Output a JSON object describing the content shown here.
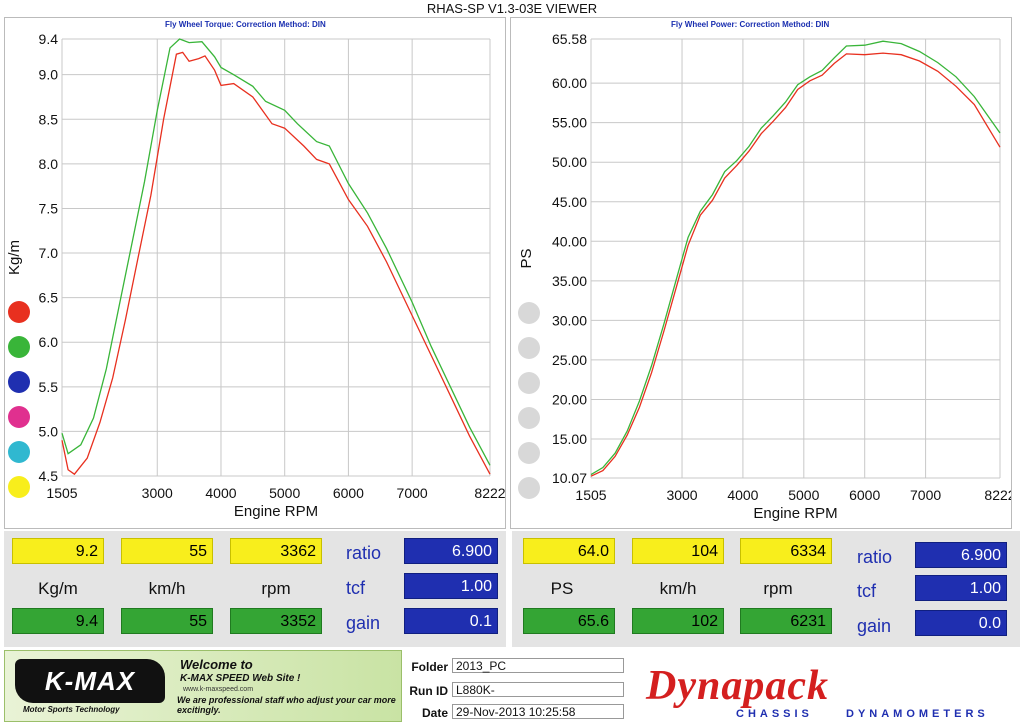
{
  "window_title": "RHAS-SP V1.3-03E VIEWER",
  "chart_data": [
    {
      "type": "line",
      "title": "Fly Wheel Torque:    Correction Method: DIN",
      "xlabel": "Engine RPM",
      "ylabel": "Kg/m",
      "xlim": [
        1505,
        8222
      ],
      "ylim": [
        4.5,
        9.4
      ],
      "x_ticks": [
        "1505",
        "3000",
        "4000",
        "5000",
        "6000",
        "7000",
        "8222"
      ],
      "y_ticks": [
        "4.5",
        "5.0",
        "5.5",
        "6.0",
        "6.5",
        "7.0",
        "7.5",
        "8.0",
        "8.5",
        "9.0",
        "9.4"
      ],
      "grid": true,
      "series": [
        {
          "color": "#39b539",
          "points": [
            [
              1505,
              4.98
            ],
            [
              1600,
              4.75
            ],
            [
              1800,
              4.85
            ],
            [
              2000,
              5.15
            ],
            [
              2200,
              5.7
            ],
            [
              2400,
              6.4
            ],
            [
              2600,
              7.1
            ],
            [
              2800,
              7.8
            ],
            [
              3000,
              8.6
            ],
            [
              3200,
              9.3
            ],
            [
              3350,
              9.4
            ],
            [
              3500,
              9.36
            ],
            [
              3700,
              9.37
            ],
            [
              3900,
              9.2
            ],
            [
              4000,
              9.08
            ],
            [
              4200,
              9.0
            ],
            [
              4500,
              8.87
            ],
            [
              4700,
              8.7
            ],
            [
              5000,
              8.6
            ],
            [
              5200,
              8.45
            ],
            [
              5500,
              8.25
            ],
            [
              5700,
              8.2
            ],
            [
              6000,
              7.78
            ],
            [
              6300,
              7.45
            ],
            [
              6600,
              7.05
            ],
            [
              7000,
              6.45
            ],
            [
              7300,
              5.95
            ],
            [
              7600,
              5.5
            ],
            [
              7900,
              5.05
            ],
            [
              8222,
              4.62
            ]
          ]
        },
        {
          "color": "#e8301f",
          "points": [
            [
              1505,
              4.9
            ],
            [
              1600,
              4.57
            ],
            [
              1700,
              4.52
            ],
            [
              1900,
              4.7
            ],
            [
              2100,
              5.1
            ],
            [
              2300,
              5.6
            ],
            [
              2500,
              6.25
            ],
            [
              2700,
              6.95
            ],
            [
              2900,
              7.65
            ],
            [
              3100,
              8.5
            ],
            [
              3300,
              9.23
            ],
            [
              3400,
              9.25
            ],
            [
              3500,
              9.15
            ],
            [
              3650,
              9.18
            ],
            [
              3750,
              9.21
            ],
            [
              3900,
              9.05
            ],
            [
              4000,
              8.88
            ],
            [
              4200,
              8.9
            ],
            [
              4500,
              8.75
            ],
            [
              4800,
              8.45
            ],
            [
              5000,
              8.4
            ],
            [
              5300,
              8.2
            ],
            [
              5500,
              8.05
            ],
            [
              5700,
              8.0
            ],
            [
              6000,
              7.6
            ],
            [
              6300,
              7.3
            ],
            [
              6600,
              6.9
            ],
            [
              7000,
              6.3
            ],
            [
              7300,
              5.85
            ],
            [
              7600,
              5.4
            ],
            [
              7900,
              4.95
            ],
            [
              8222,
              4.52
            ]
          ]
        }
      ]
    },
    {
      "type": "line",
      "title": "Fly Wheel Power:    Correction Method: DIN",
      "xlabel": "Engine RPM",
      "ylabel": "PS",
      "xlim": [
        1505,
        8222
      ],
      "ylim": [
        10.07,
        65.58
      ],
      "x_ticks": [
        "1505",
        "3000",
        "4000",
        "5000",
        "6000",
        "7000",
        "8222"
      ],
      "y_ticks": [
        "10.07",
        "15.00",
        "20.00",
        "25.00",
        "30.00",
        "35.00",
        "40.00",
        "45.00",
        "50.00",
        "55.00",
        "60.00",
        "65.58"
      ],
      "grid": true,
      "series": [
        {
          "color": "#39b539",
          "points": [
            [
              1505,
              10.5
            ],
            [
              1700,
              11.4
            ],
            [
              1900,
              13.2
            ],
            [
              2100,
              16.0
            ],
            [
              2300,
              19.8
            ],
            [
              2500,
              24.3
            ],
            [
              2700,
              29.5
            ],
            [
              2900,
              35.0
            ],
            [
              3100,
              40.5
            ],
            [
              3300,
              43.8
            ],
            [
              3500,
              45.9
            ],
            [
              3700,
              48.8
            ],
            [
              3900,
              50.2
            ],
            [
              4100,
              52.0
            ],
            [
              4300,
              54.3
            ],
            [
              4500,
              55.9
            ],
            [
              4700,
              57.6
            ],
            [
              4900,
              59.8
            ],
            [
              5100,
              60.8
            ],
            [
              5300,
              61.6
            ],
            [
              5500,
              63.2
            ],
            [
              5700,
              64.7
            ],
            [
              6000,
              64.8
            ],
            [
              6300,
              65.3
            ],
            [
              6600,
              65.0
            ],
            [
              6900,
              64.0
            ],
            [
              7200,
              62.6
            ],
            [
              7500,
              60.8
            ],
            [
              7800,
              58.3
            ],
            [
              8222,
              53.7
            ]
          ]
        },
        {
          "color": "#e8301f",
          "points": [
            [
              1505,
              10.3
            ],
            [
              1700,
              11.0
            ],
            [
              1900,
              12.8
            ],
            [
              2100,
              15.5
            ],
            [
              2300,
              19.0
            ],
            [
              2500,
              23.4
            ],
            [
              2700,
              28.6
            ],
            [
              2900,
              34.0
            ],
            [
              3100,
              39.5
            ],
            [
              3300,
              43.3
            ],
            [
              3500,
              45.2
            ],
            [
              3700,
              48.0
            ],
            [
              3900,
              49.6
            ],
            [
              4100,
              51.4
            ],
            [
              4300,
              53.6
            ],
            [
              4500,
              55.2
            ],
            [
              4700,
              56.9
            ],
            [
              4900,
              59.2
            ],
            [
              5100,
              60.3
            ],
            [
              5300,
              61.0
            ],
            [
              5500,
              62.5
            ],
            [
              5700,
              63.7
            ],
            [
              6000,
              63.6
            ],
            [
              6300,
              63.8
            ],
            [
              6600,
              63.6
            ],
            [
              6900,
              62.8
            ],
            [
              7200,
              61.5
            ],
            [
              7500,
              59.6
            ],
            [
              7800,
              57.3
            ],
            [
              8222,
              51.9
            ]
          ]
        }
      ]
    }
  ],
  "left_readouts": {
    "top": [
      "9.2",
      "55",
      "3362"
    ],
    "units": [
      "Kg/m",
      "km/h",
      "rpm"
    ],
    "bottom": [
      "9.4",
      "55",
      "3352"
    ],
    "params": [
      {
        "label": "ratio",
        "value": "6.900"
      },
      {
        "label": "tcf",
        "value": "1.00"
      },
      {
        "label": "gain",
        "value": "0.1"
      }
    ]
  },
  "right_readouts": {
    "top": [
      "64.0",
      "104",
      "6334"
    ],
    "units": [
      "PS",
      "km/h",
      "rpm"
    ],
    "bottom": [
      "65.6",
      "102",
      "6231"
    ],
    "params": [
      {
        "label": "ratio",
        "value": "6.900"
      },
      {
        "label": "tcf",
        "value": "1.00"
      },
      {
        "label": "gain",
        "value": "0.0"
      }
    ]
  },
  "left_dots": [
    "#e8301f",
    "#39b539",
    "#1f2fb0",
    "#e0308f",
    "#30b8d0",
    "#f8ee1c"
  ],
  "right_dots": [
    "#d8d8d8",
    "#d8d8d8",
    "#d8d8d8",
    "#d8d8d8",
    "#d8d8d8",
    "#d8d8d8"
  ],
  "footer": {
    "kmax_logo": "K-MAX",
    "kmax_sub": "Motor Sports Technology",
    "welcome": "Welcome to",
    "website": "K-MAX SPEED Web Site !",
    "website_url": "www.k-maxspeed.com",
    "tagline": "We are professional staff who adjust your car more excitingly.",
    "folder_label": "Folder",
    "folder": "2013_PC",
    "runid_label": "Run ID",
    "runid": "L880K-",
    "date_label": "Date",
    "date": "29-Nov-2013  10:25:58",
    "dyn_logo": "Dynapack",
    "dyn_sub1": "CHASSIS",
    "dyn_sub2": "DYNAMOMETERS"
  }
}
